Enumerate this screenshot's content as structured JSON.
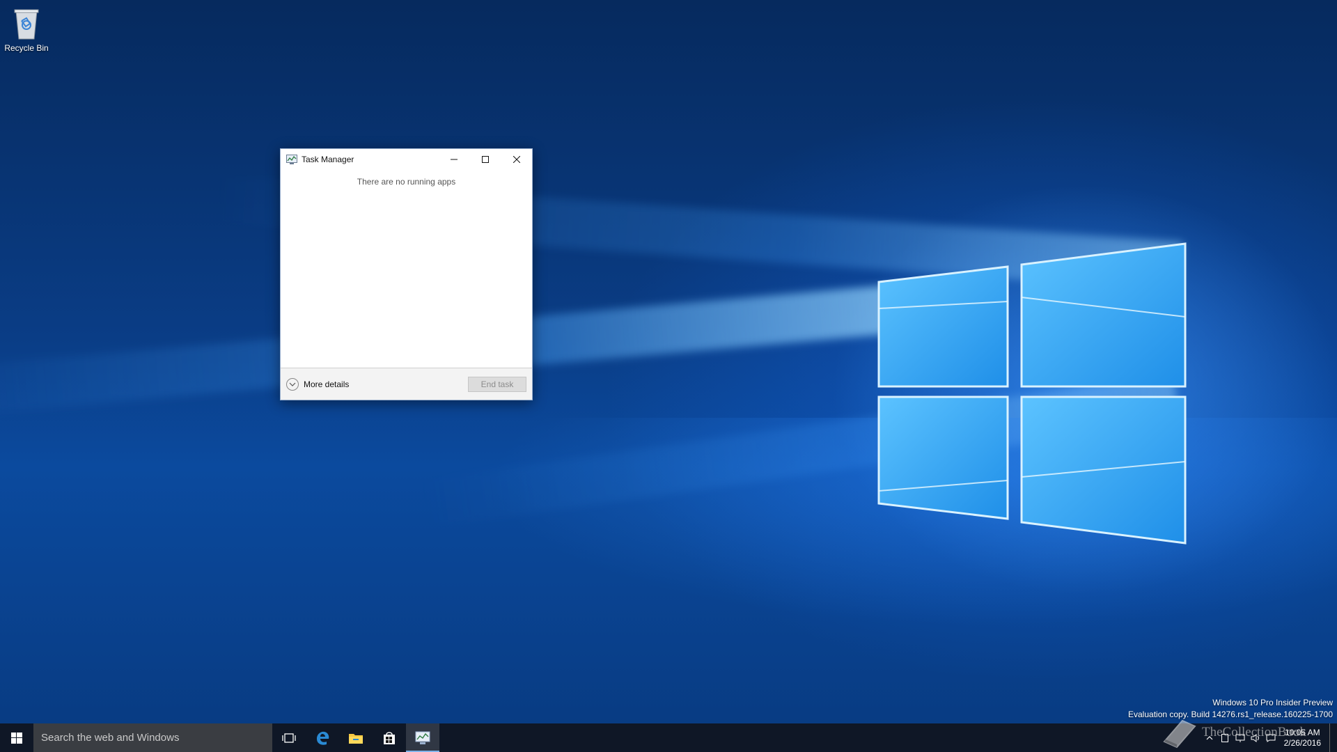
{
  "desktop": {
    "icons": [
      {
        "label": "Recycle Bin",
        "icon": "recycle-bin-icon"
      }
    ],
    "watermark": {
      "line1": "Windows 10 Pro Insider Preview",
      "line2": "Evaluation copy. Build 14276.rs1_release.160225-1700"
    },
    "overlay_logo_text": "TheCollectionBook"
  },
  "task_manager": {
    "title": "Task Manager",
    "empty_message": "There are no running apps",
    "more_details_label": "More details",
    "end_task_label": "End task",
    "controls": [
      "minimize-icon",
      "maximize-icon",
      "close-icon"
    ]
  },
  "taskbar": {
    "search_placeholder": "Search the web and Windows",
    "pinned": [
      "start-icon",
      "task-view-icon",
      "edge-icon",
      "file-explorer-icon",
      "store-icon",
      "task-manager-icon"
    ],
    "active_app": "task-manager-icon",
    "tray_icons": [
      "chevron-up-icon",
      "tablet-icon",
      "network-icon",
      "volume-icon",
      "action-center-icon"
    ],
    "clock": {
      "time": "10:05 AM",
      "date": "2/26/2016"
    }
  },
  "colors": {
    "accent": "#0078d7",
    "taskbar": "#10161f",
    "search_box": "#3a3d42",
    "wallpaper": "#0a3d86"
  }
}
